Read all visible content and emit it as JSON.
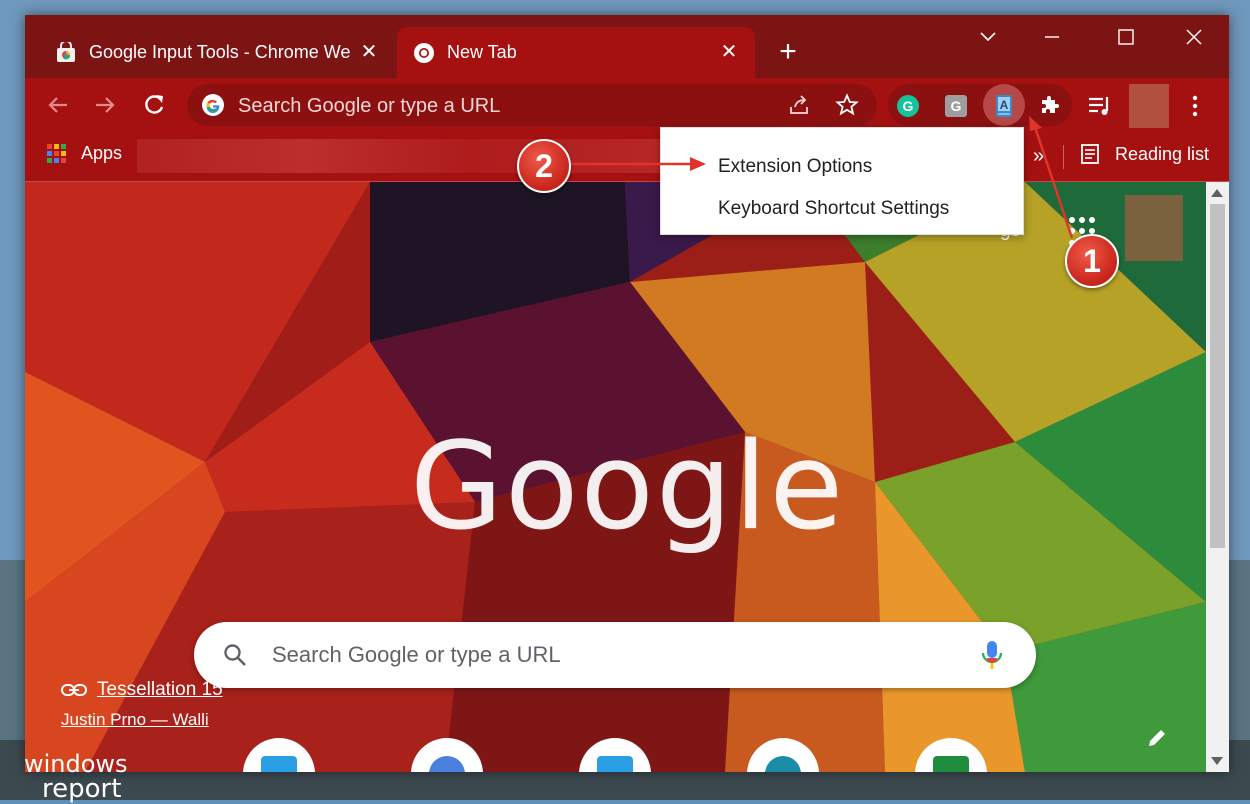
{
  "tabs": [
    {
      "title": "Google Input Tools - Chrome Web Store",
      "active": false
    },
    {
      "title": "New Tab",
      "active": true
    }
  ],
  "omnibox": {
    "placeholder": "Search Google or type a URL"
  },
  "bookmarks_bar": {
    "apps_label": "Apps",
    "reading_list_label": "Reading list",
    "overflow_glyph": "»"
  },
  "extensions": [
    {
      "icon": "grammarly-icon",
      "letter": "G"
    },
    {
      "icon": "g-extension-icon",
      "letter": "G"
    },
    {
      "icon": "google-input-tools-icon",
      "letter": "A"
    }
  ],
  "context_menu": {
    "items": [
      "Extension Options",
      "Keyboard Shortcut Settings"
    ]
  },
  "ntp": {
    "logo_text": "Google",
    "search_placeholder": "Search Google or type a URL",
    "header_fragment": "gs",
    "background_credit_title": "Tessellation 15",
    "background_credit_author": "Justin Prno — Walli"
  },
  "annotations": {
    "step1": "1",
    "step2": "2"
  },
  "watermark": {
    "line1": "windows",
    "line2": "report"
  },
  "colors": {
    "frame": "#7d1414",
    "toolbar": "#a51111",
    "annotation_red": "#e0342a"
  }
}
